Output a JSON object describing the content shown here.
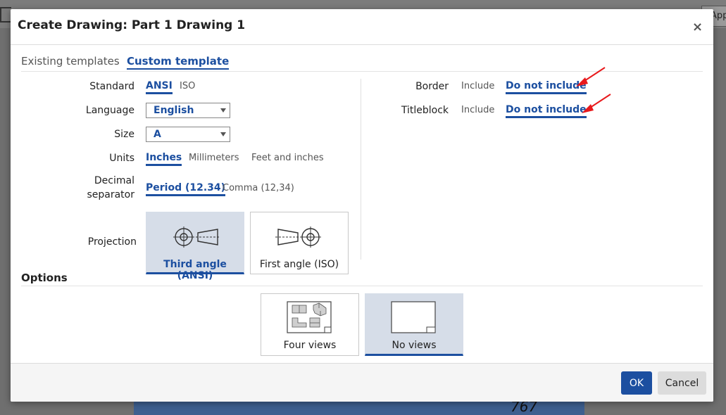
{
  "background": {
    "tab_label": "App",
    "corner_number": "767"
  },
  "dialog": {
    "title": "Create Drawing: Part 1 Drawing 1",
    "close_glyph": "×"
  },
  "tabs": {
    "existing": "Existing templates",
    "custom": "Custom template"
  },
  "form": {
    "standard": {
      "label": "Standard",
      "options": [
        "ANSI",
        "ISO"
      ],
      "selected": "ANSI"
    },
    "language": {
      "label": "Language",
      "value": "English"
    },
    "size": {
      "label": "Size",
      "value": "A"
    },
    "units": {
      "label": "Units",
      "options": [
        "Inches",
        "Millimeters",
        "Feet and inches"
      ],
      "selected": "Inches"
    },
    "decimal": {
      "label_line1": "Decimal",
      "label_line2": "separator",
      "options": [
        "Period (12.34)",
        "Comma (12,34)"
      ],
      "selected": "Period (12.34)"
    },
    "projection": {
      "label": "Projection",
      "options": [
        "Third angle (ANSI)",
        "First angle (ISO)"
      ],
      "selected": "Third angle (ANSI)"
    },
    "border": {
      "label": "Border",
      "options": [
        "Include",
        "Do not include"
      ],
      "selected": "Do not include"
    },
    "titleblock": {
      "label": "Titleblock",
      "options": [
        "Include",
        "Do not include"
      ],
      "selected": "Do not include"
    }
  },
  "options": {
    "heading": "Options",
    "views": [
      "Four views",
      "No views"
    ],
    "selected": "No views"
  },
  "footer": {
    "ok": "OK",
    "cancel": "Cancel"
  },
  "colors": {
    "accent": "#1c4fa0",
    "selected_bg": "#d6dde8",
    "annotation_arrow": "#e8191c"
  },
  "icons": [
    "close-icon",
    "dropdown-caret-icon",
    "third-angle-projection-icon",
    "first-angle-projection-icon",
    "four-views-icon",
    "no-views-icon",
    "annotation-arrow"
  ]
}
